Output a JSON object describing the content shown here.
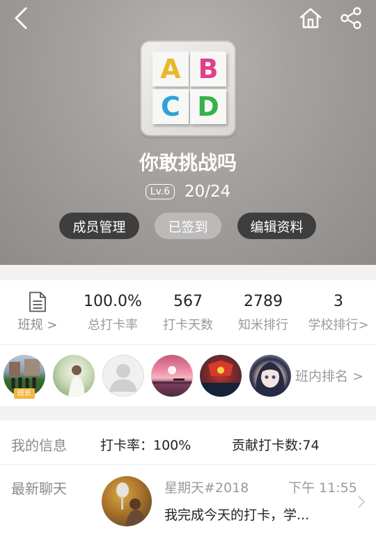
{
  "header": {
    "back_icon": "chevron-left-icon",
    "home_icon": "home-icon",
    "share_icon": "share-icon"
  },
  "group": {
    "cover_letters": [
      "A",
      "B",
      "C",
      "D"
    ],
    "name": "你敢挑战吗",
    "level": "Lv.6",
    "progress": "20/24"
  },
  "actions": {
    "members": "成员管理",
    "checked_in": "已签到",
    "edit": "编辑资料"
  },
  "stats": {
    "rules_label": "班规 >",
    "rate_value": "100.0%",
    "rate_label": "总打卡率",
    "days_value": "567",
    "days_label": "打卡天数",
    "rank_value": "2789",
    "rank_label": "知米排行",
    "school_value": "3",
    "school_label": "学校排行>"
  },
  "members": {
    "monitor_badge": "班长",
    "rank_link": "班内排名 >"
  },
  "my_info": {
    "title": "我的信息",
    "rate": "打卡率：100%",
    "contribution": "贡献打卡数:74"
  },
  "chat": {
    "title": "最新聊天",
    "sender": "星期天#2018",
    "time": "下午 11:55",
    "message": "我完成今天的打卡，学..."
  },
  "colors": {
    "pill_dark": "#3e3e3e",
    "pill_light": "#bcbab9",
    "monitor_badge": "#f4b63f"
  }
}
